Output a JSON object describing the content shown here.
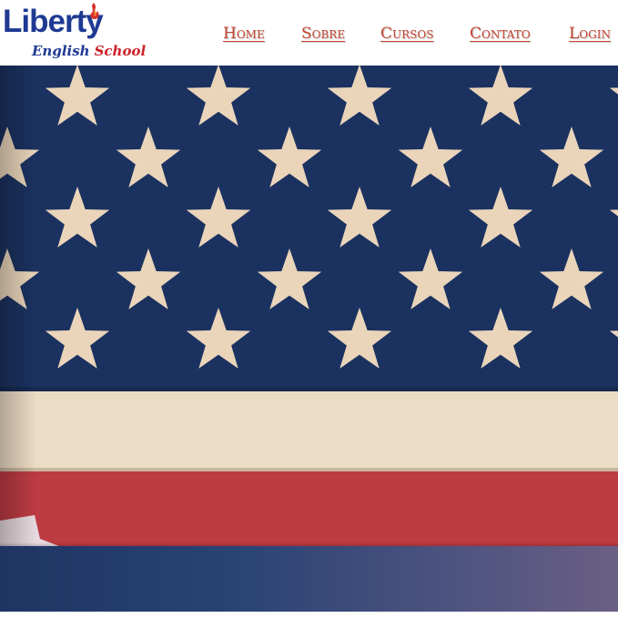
{
  "brand": {
    "name": "Liberty",
    "subtitle_part1": "English",
    "subtitle_part2": "School",
    "primary_color": "#1f3a93",
    "accent_color": "#cc2228"
  },
  "nav": {
    "items": [
      {
        "label": "Home"
      },
      {
        "label": "Sobre"
      },
      {
        "label": "Cursos"
      },
      {
        "label": "Contato"
      },
      {
        "label": "Login"
      }
    ],
    "link_color": "#c4432e"
  },
  "hero": {
    "image": "american-flag",
    "colors": {
      "blue": "#1b3260",
      "star": "#ead5bb",
      "cream": "#eddcc5",
      "red": "#bd3b43"
    }
  }
}
